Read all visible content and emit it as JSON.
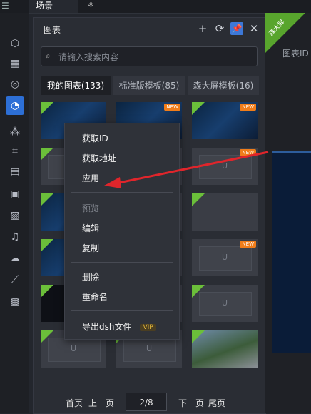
{
  "topbar": {
    "scene_tab": "场景",
    "menu_icon": "menu-icon",
    "tree_icon": "sitemap-icon"
  },
  "sidebar": {
    "icons": [
      "cube-icon",
      "building-icon",
      "chart-ring-icon",
      "clock-chart-icon",
      "nodes-icon",
      "crop-icon",
      "layout-icon",
      "image-icon",
      "picture-icon",
      "music-icon",
      "cloud-icon",
      "line-chart-icon",
      "grid-icon"
    ]
  },
  "panel": {
    "title": "图表",
    "search_placeholder": "请输入搜索内容",
    "tabs": [
      {
        "label": "我的图表(133)"
      },
      {
        "label": "标准版模板(85)"
      },
      {
        "label": "森大屏模板(16)"
      }
    ],
    "new_badge": "NEW",
    "placeholder_logo": "U"
  },
  "context_menu": {
    "items": [
      "获取ID",
      "获取地址",
      "应用",
      "预览",
      "编辑",
      "复制",
      "删除",
      "重命名",
      "导出dsh文件"
    ],
    "vip_badge": "VIP"
  },
  "pager": {
    "first": "首页",
    "prev": "上一页",
    "page": "2/8",
    "next": "下一页",
    "last": "尾页"
  },
  "right_panel": {
    "ribbon": "森大屏",
    "chart_id_label": "图表ID :"
  },
  "colors": {
    "accent": "#2d6fd6",
    "new_badge": "#f07d1a",
    "ribbon": "#58a52d",
    "arrow": "#e0252b"
  }
}
